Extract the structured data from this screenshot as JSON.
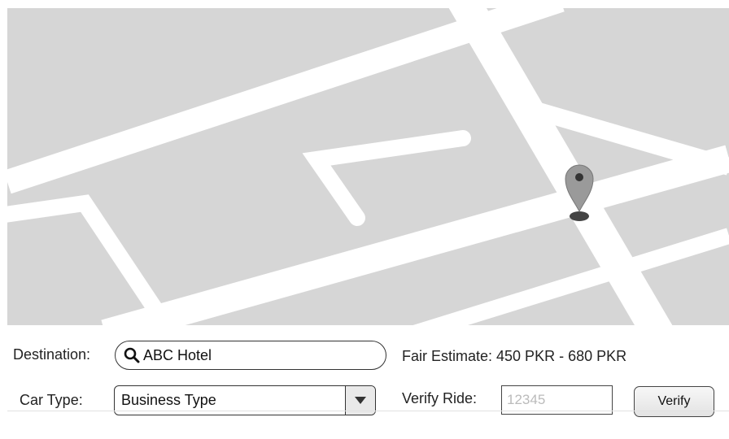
{
  "destination": {
    "label": "Destination:",
    "value": "ABC Hotel",
    "icon": "search-icon"
  },
  "fare": {
    "text": "Fair Estimate: 450 PKR - 680 PKR"
  },
  "car_type": {
    "label": "Car Type:",
    "selected": "Business Type",
    "icon": "chevron-down-icon"
  },
  "verify": {
    "label": "Verify Ride:",
    "placeholder": "12345",
    "button_label": "Verify"
  },
  "map": {
    "pin_icon": "map-pin-icon",
    "land_color": "#d6d6d6",
    "road_color": "#ffffff",
    "pin_color": "#9a9a9a"
  }
}
